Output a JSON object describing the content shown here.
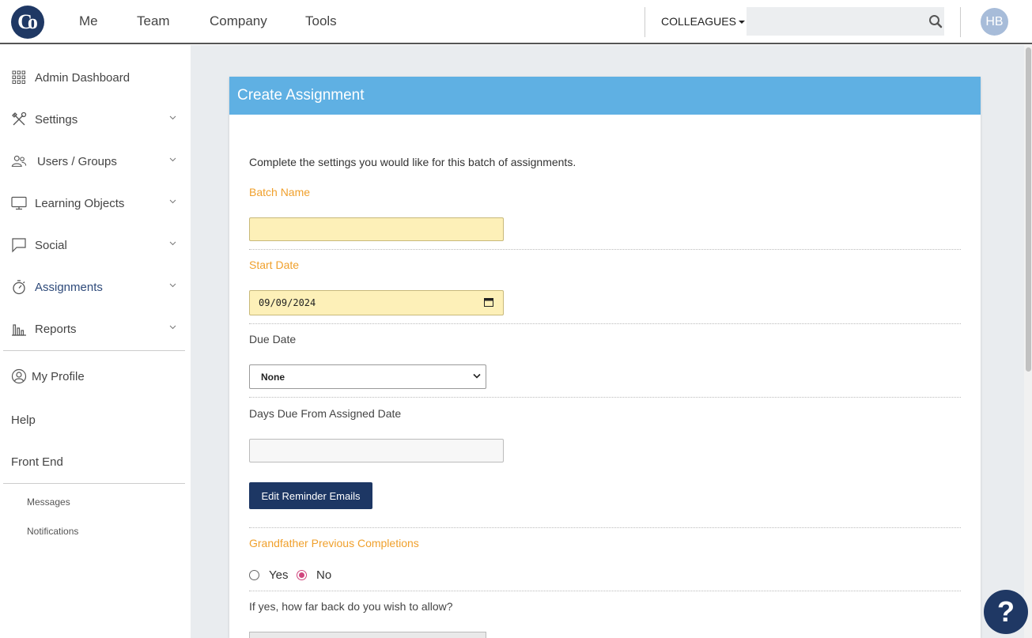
{
  "topnav": {
    "items": [
      "Me",
      "Team",
      "Company",
      "Tools"
    ],
    "colleagues_label": "COLLEAGUES",
    "avatar_initials": "HB"
  },
  "sidebar": {
    "items": [
      {
        "label": "Admin Dashboard",
        "icon": "grid-icon"
      },
      {
        "label": "Settings",
        "icon": "tools-icon"
      },
      {
        "label": "Users / Groups",
        "icon": "users-icon"
      },
      {
        "label": "Learning Objects",
        "icon": "monitor-icon"
      },
      {
        "label": "Social",
        "icon": "chat-icon"
      },
      {
        "label": "Assignments",
        "icon": "stopwatch-icon"
      },
      {
        "label": "Reports",
        "icon": "bar-chart-icon"
      }
    ],
    "my_profile": "My Profile",
    "help": "Help",
    "front_end": "Front End",
    "messages": "Messages",
    "notifications": "Notifications"
  },
  "form": {
    "title": "Create Assignment",
    "intro": "Complete the settings you would like for this batch of assignments.",
    "batch_name_label": "Batch Name",
    "batch_name_value": "",
    "start_date_label": "Start Date",
    "start_date_value": "09/09/2024",
    "due_date_label": "Due Date",
    "due_date_value": "None",
    "days_due_label": "Days Due From Assigned Date",
    "days_due_value": "",
    "reminder_button": "Edit Reminder Emails",
    "grandfather_label": "Grandfather Previous Completions",
    "yes_label": "Yes",
    "no_label": "No",
    "grandfather_selected": "No",
    "how_far_label": "If yes, how far back do you wish to allow?"
  },
  "help_button": "?",
  "colors": {
    "header_blue": "#5fb0e3",
    "navy": "#1d3764",
    "orange_label": "#f0a02c",
    "input_yellow": "#fdf0b8",
    "radio_pink": "#d0457d"
  }
}
